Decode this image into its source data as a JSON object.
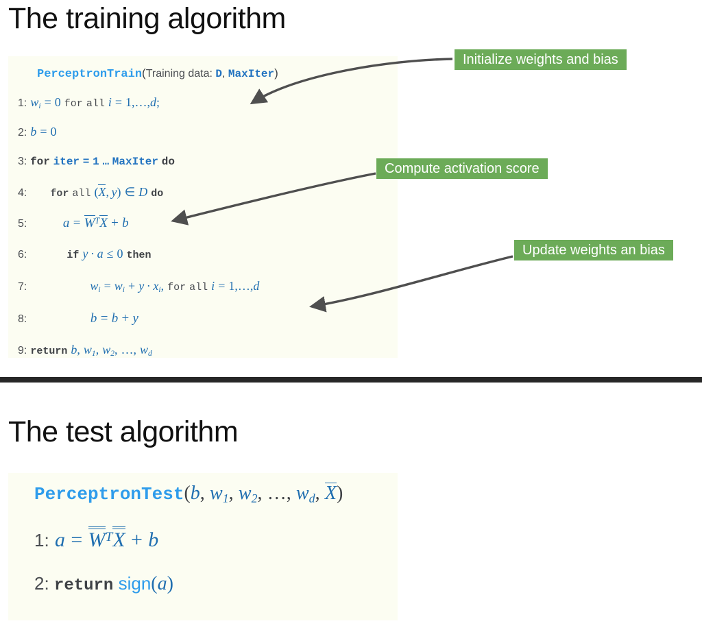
{
  "slides": [
    {
      "id": "training",
      "title": "The training algorithm",
      "panel": {
        "signature": {
          "name": "PerceptronTrain",
          "open_paren": "(",
          "arg_label": "Training data:",
          "arg1": "D",
          "comma": ",",
          "arg2": "MaxIter",
          "close_paren": ")"
        },
        "lines": [
          {
            "n": "1:",
            "text": "w_i = 0 for all i = 1,…,d;"
          },
          {
            "n": "2:",
            "text": "b = 0"
          },
          {
            "n": "3:",
            "text": "for iter = 1 … MaxIter do"
          },
          {
            "n": "4:",
            "text": "for all (X̄, y) ∈ D do"
          },
          {
            "n": "5:",
            "text": "a = W̄^T X̄ + b"
          },
          {
            "n": "6:",
            "text": "if y · a ≤ 0 then"
          },
          {
            "n": "7:",
            "text": "w_i = w_i + y · x_i, for all i = 1,…,d"
          },
          {
            "n": "8:",
            "text": "b = b + y"
          },
          {
            "n": "9:",
            "text": "return b, w_1, w_2, …, w_d"
          }
        ]
      },
      "callouts": [
        {
          "id": "init",
          "label": "Initialize weights and bias",
          "target_line": "1"
        },
        {
          "id": "act",
          "label": "Compute activation score",
          "target_line": "5"
        },
        {
          "id": "update",
          "label": "Update weights an bias",
          "target_line": "7"
        }
      ]
    },
    {
      "id": "test",
      "title": "The test algorithm",
      "panel": {
        "signature": {
          "name": "PerceptronTest",
          "open_paren": "(",
          "args": "b, w_1, w_2, …, w_d, X̄",
          "close_paren": ")"
        },
        "lines": [
          {
            "n": "1:",
            "text": "a = W̄^T X̄ + b"
          },
          {
            "n": "2:",
            "text": "return sign(a)"
          }
        ]
      }
    }
  ],
  "tokens": {
    "for": "for",
    "all": "all",
    "iter": "iter",
    "maxiter": "MaxIter",
    "do": "do",
    "if": "if",
    "then": "then",
    "return": "return",
    "sign": "sign",
    "D": "D",
    "eq": "=",
    "plus": "+",
    "dot": "·",
    "leq": "≤",
    "in": "∈",
    "ellipsis": "…",
    "comma": ",",
    "semicolon": ";",
    "zero": "0",
    "one": "1",
    "two": "2",
    "lparen": "(",
    "rparen": ")",
    "a": "a",
    "b": "b",
    "d": "d",
    "i": "i",
    "w": "w",
    "W": "W",
    "X": "X",
    "x": "x",
    "y": "y",
    "T": "T"
  },
  "colors": {
    "panel_background": "#fcfdf2",
    "callout_green": "#6cab58",
    "code_blue": "#2e9ceb",
    "math_blue": "#1f6eb0",
    "keyword_dark": "#3f4246",
    "divider": "#272727",
    "arrow": "#4f4f4f",
    "title": "#111111"
  }
}
